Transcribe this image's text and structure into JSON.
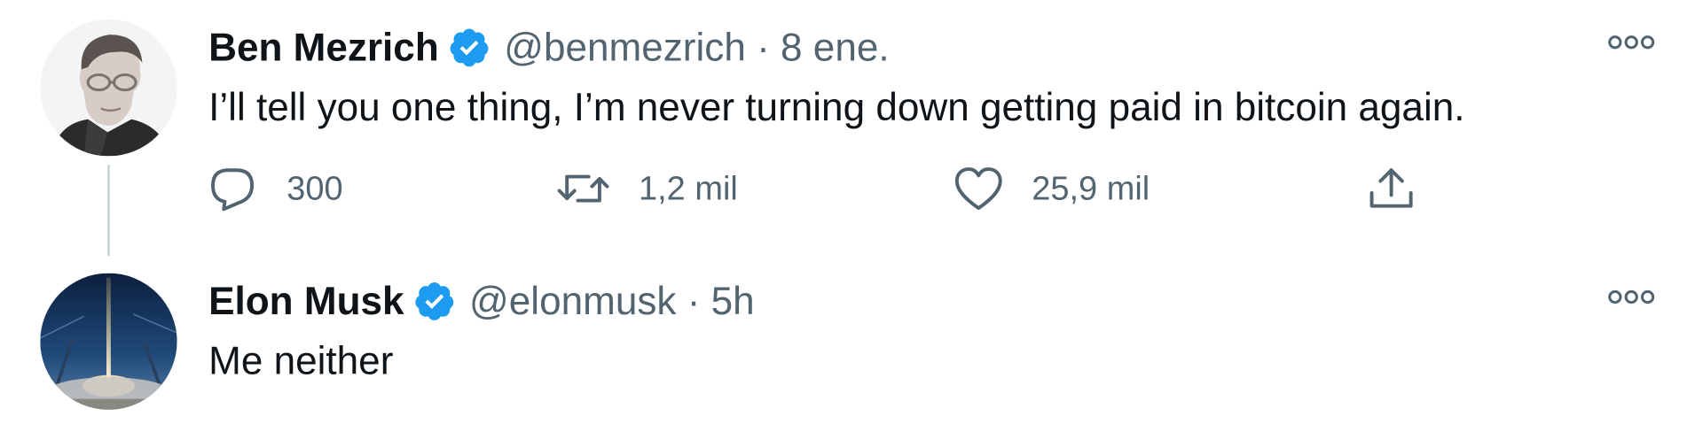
{
  "tweets": [
    {
      "name": "Ben Mezrich",
      "handle": "@benmezrich",
      "separator": "·",
      "time": "8 ene.",
      "text": "I’ll tell you one thing, I’m never turning down getting paid in bitcoin again.",
      "verified": true,
      "actions": {
        "reply_icon": "reply-icon",
        "reply_count": "300",
        "retweet_icon": "retweet-icon",
        "retweet_count": "1,2 mil",
        "like_icon": "heart-icon",
        "like_count": "25,9 mil",
        "share_icon": "share-icon"
      }
    },
    {
      "name": "Elon Musk",
      "handle": "@elonmusk",
      "separator": "·",
      "time": "5h",
      "text": "Me neither",
      "verified": true
    }
  ],
  "icons": {
    "verified": "verified-badge-icon",
    "more": "more-options-icon"
  },
  "colors": {
    "verified_blue": "#1d9bf0",
    "text_primary": "#0f1419",
    "text_secondary": "#536471",
    "thread_line": "#c4cfd6"
  }
}
